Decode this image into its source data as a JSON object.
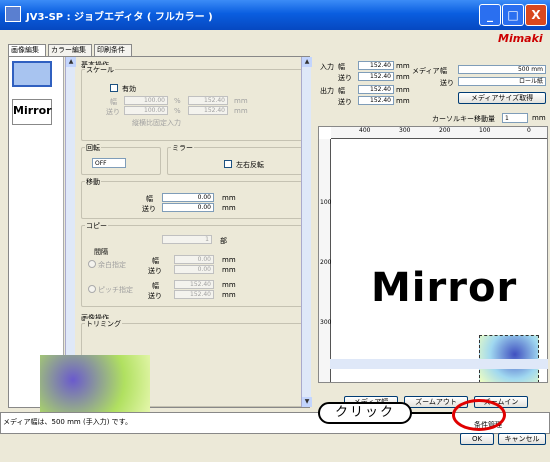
{
  "window": {
    "title": "JV3-SP : ジョブエディタ ( フルカラー )",
    "min": "_",
    "max": "□",
    "close": "X",
    "logo": "Mimaki"
  },
  "tabs": [
    "画像編集",
    "カラー編集",
    "印刷条件"
  ],
  "thumbs": {
    "mirror_label": "Mirror"
  },
  "basic": {
    "heading": "基本操作",
    "scale": "スケール",
    "enable": "有効",
    "width": "幅",
    "feed": "送り",
    "scale_w": "100.00",
    "scale_f": "100.00",
    "pct": "%",
    "val_w": "152.40",
    "val_f": "152.40",
    "mm": "mm",
    "keep_ratio": "縦横比固定入力"
  },
  "rotate": {
    "label": "回転",
    "value": "OFF"
  },
  "mirror": {
    "label": "ミラー",
    "option": "左右反転"
  },
  "move": {
    "label": "移動",
    "width": "幅",
    "feed": "送り",
    "w": "0.00",
    "f": "0.00",
    "mm": "mm"
  },
  "copy": {
    "label": "コピー",
    "count": "1",
    "unit": "部",
    "gap": "間隔",
    "auto": "余白指定",
    "pitch": "ピッチ指定",
    "width": "幅",
    "feed": "送り",
    "auto_w": "0.00",
    "auto_f": "0.00",
    "pitch_w": "152.40",
    "pitch_f": "152.40",
    "mm": "mm"
  },
  "image_op": {
    "label": "画像操作",
    "trim": "トリミング"
  },
  "info": {
    "input": "入力",
    "output": "出力",
    "width": "幅",
    "feed": "送り",
    "in_w": "152.40",
    "in_f": "152.40",
    "out_w": "152.40",
    "out_f": "152.40",
    "mm": "mm",
    "media": "メディア",
    "media_w_label": "幅",
    "media_f_label": "送り",
    "media_w": "500 mm",
    "media_f": "ロール紙",
    "get_size": "メディアサイズ取得",
    "cursor": "カーソルキー移動量",
    "cursor_val": "1",
    "cursor_unit": "mm"
  },
  "ruler": {
    "h": [
      "400",
      "300",
      "200",
      "100",
      "0"
    ],
    "v": [
      "100",
      "200",
      "300"
    ]
  },
  "canvas": {
    "text": "Mirror"
  },
  "bottom_buttons": [
    "メディア幅",
    "ズームアウト",
    "ズームイン"
  ],
  "status": "メディア幅は、500 mm (手入力) です。",
  "annot": {
    "click": "クリック"
  },
  "footer": {
    "manage": "条件管理",
    "ok": "OK",
    "cancel": "キャンセル"
  }
}
